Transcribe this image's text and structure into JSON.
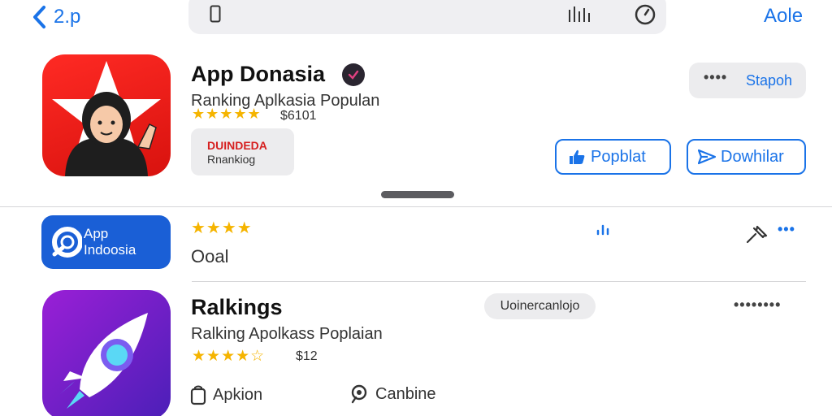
{
  "nav": {
    "back_label": "2.p",
    "right_link": "Aole"
  },
  "apps": [
    {
      "title": "App Donasia",
      "subtitle": "Ranking Aplkasia Populan",
      "stars": "★★★★★",
      "price": "$6101",
      "chip_line1": "DUINDEDA",
      "chip_line2": "Rnankiog"
    },
    {
      "icon_line1": "App",
      "icon_line2": "Indoosia",
      "stars": "★★★★",
      "subtitle": "Ooal"
    },
    {
      "title": "Ralkings",
      "subtitle": "Ralking Apolkass Poplaian",
      "stars": "★★★★☆",
      "price": "$12",
      "pill": "Uoinercanlojo"
    }
  ],
  "buttons": {
    "more_dots": "••••",
    "grey_label": "Stapoh",
    "popular_label": "Popblat",
    "download_label": "Dowhilar",
    "row2_more": "•••",
    "row3_more": "••••••••",
    "action1": "Apkion",
    "action2": "Canbine"
  },
  "colors": {
    "accent": "#1a73e8",
    "star": "#f5b400",
    "icon1_bg": "#e61a16",
    "icon2_bg": "#1a5fd6",
    "icon3_bg": "#7a1fd0"
  },
  "icons": [
    "chevron-left-icon",
    "phone-icon",
    "bars-icon",
    "clock-icon",
    "verified-icon",
    "thumbs-up-icon",
    "send-icon",
    "signal-icon",
    "pin-icon",
    "bag-icon",
    "location-icon"
  ]
}
